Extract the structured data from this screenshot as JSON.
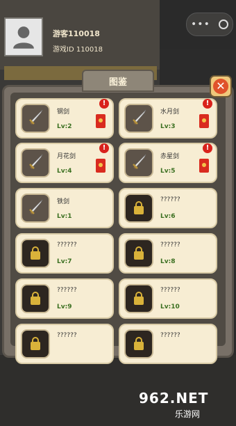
{
  "header": {
    "player_name": "游客110018",
    "player_id": "游戏ID 110018"
  },
  "dialog": {
    "title": "图鉴",
    "close_icon": "close-icon"
  },
  "items": [
    {
      "name": "钢剑",
      "level": "Lv:2",
      "locked": false,
      "alert": "!"
    },
    {
      "name": "水月剑",
      "level": "Lv:3",
      "locked": false,
      "alert": "!"
    },
    {
      "name": "月花剑",
      "level": "Lv:4",
      "locked": false,
      "alert": "!"
    },
    {
      "name": "赤星剑",
      "level": "Lv:5",
      "locked": false,
      "alert": "!"
    },
    {
      "name": "铁剑",
      "level": "Lv:1",
      "locked": false
    },
    {
      "name": "??????",
      "level": "Lv:6",
      "locked": true
    },
    {
      "name": "??????",
      "level": "Lv:7",
      "locked": true
    },
    {
      "name": "??????",
      "level": "Lv:8",
      "locked": true
    },
    {
      "name": "??????",
      "level": "Lv:9",
      "locked": true
    },
    {
      "name": "??????",
      "level": "Lv:10",
      "locked": true
    },
    {
      "name": "??????",
      "level": "",
      "locked": true
    },
    {
      "name": "??????",
      "level": "",
      "locked": true
    }
  ],
  "watermark": {
    "brand": "962.NET",
    "sub": "乐游网"
  },
  "colors": {
    "level_text": "#3a6f20",
    "alert": "#d9221c",
    "card_bg": "#f7edd3"
  }
}
